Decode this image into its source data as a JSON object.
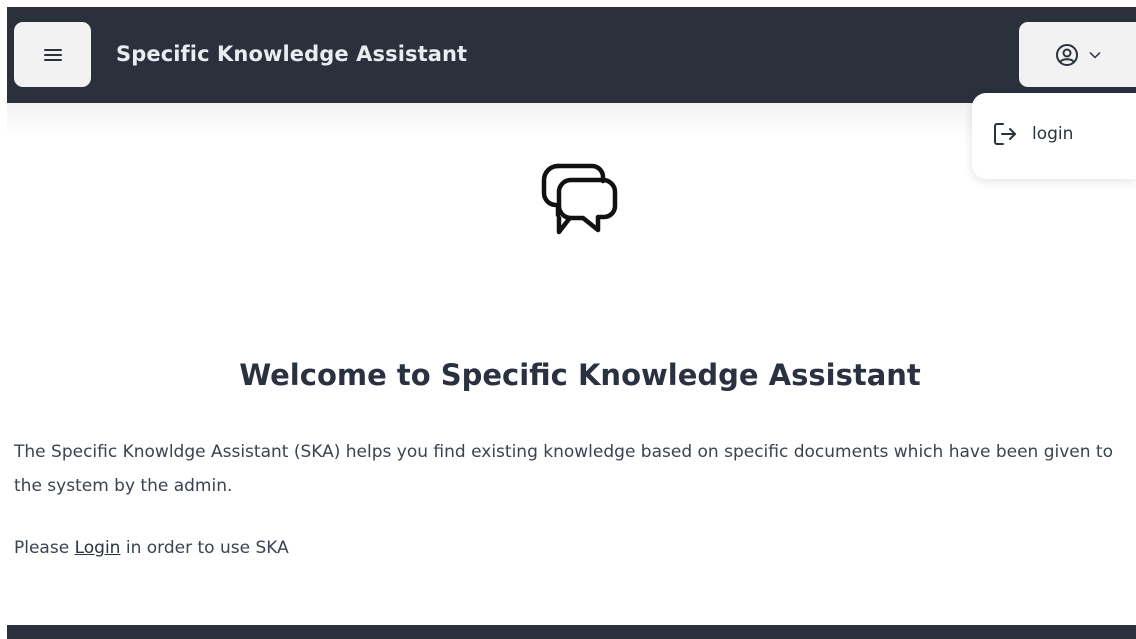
{
  "app": {
    "title": "Specific Knowledge Assistant"
  },
  "navbar": {
    "menu_icon": "hamburger-icon",
    "user_icon": "user-circle-icon",
    "user_chevron_icon": "chevron-down-icon"
  },
  "user_menu": {
    "items": [
      {
        "icon": "login-icon",
        "label": "login"
      }
    ]
  },
  "main": {
    "hero_icon": "chat-bubbles-icon",
    "heading": "Welcome to Specific Knowledge Assistant",
    "description": "The Specific Knowldge Assistant (SKA) helps you find existing knowledge based on specific documents which have been given to the system by the admin.",
    "login_prompt": {
      "prefix": "Please ",
      "link_text": "Login",
      "suffix": " in order to use SKA"
    }
  },
  "colors": {
    "navbar_bg": "#2a313d",
    "title_text": "#e9ecf1",
    "button_bg": "#f2f2f2",
    "heading_text": "#2a3140"
  }
}
